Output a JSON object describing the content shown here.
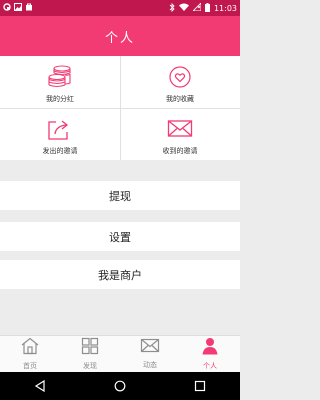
{
  "status_bar": {
    "time": "11:03",
    "icons": [
      "app-icon",
      "image-icon",
      "store-icon",
      "bluetooth-icon",
      "wifi-icon",
      "no-sim-icon",
      "battery-icon"
    ]
  },
  "header": {
    "title": "个人"
  },
  "grid": [
    {
      "label": "我的分红",
      "icon": "coins-icon"
    },
    {
      "label": "我的收藏",
      "icon": "heart-icon"
    },
    {
      "label": "发出的邀请",
      "icon": "share-icon"
    },
    {
      "label": "收到的邀请",
      "icon": "mail-icon"
    }
  ],
  "menu": [
    {
      "label": "提现"
    },
    {
      "label": "设置"
    },
    {
      "label": "我是商户"
    }
  ],
  "tabs": [
    {
      "label": "首页",
      "icon": "home-icon",
      "active": false
    },
    {
      "label": "发现",
      "icon": "discover-grid-icon",
      "active": false
    },
    {
      "label": "动态",
      "icon": "message-icon",
      "active": false
    },
    {
      "label": "个人",
      "icon": "person-icon",
      "active": true
    }
  ],
  "colors": {
    "accent": "#f23a73",
    "status": "#c0174f",
    "inactive": "#8e8e8e"
  }
}
